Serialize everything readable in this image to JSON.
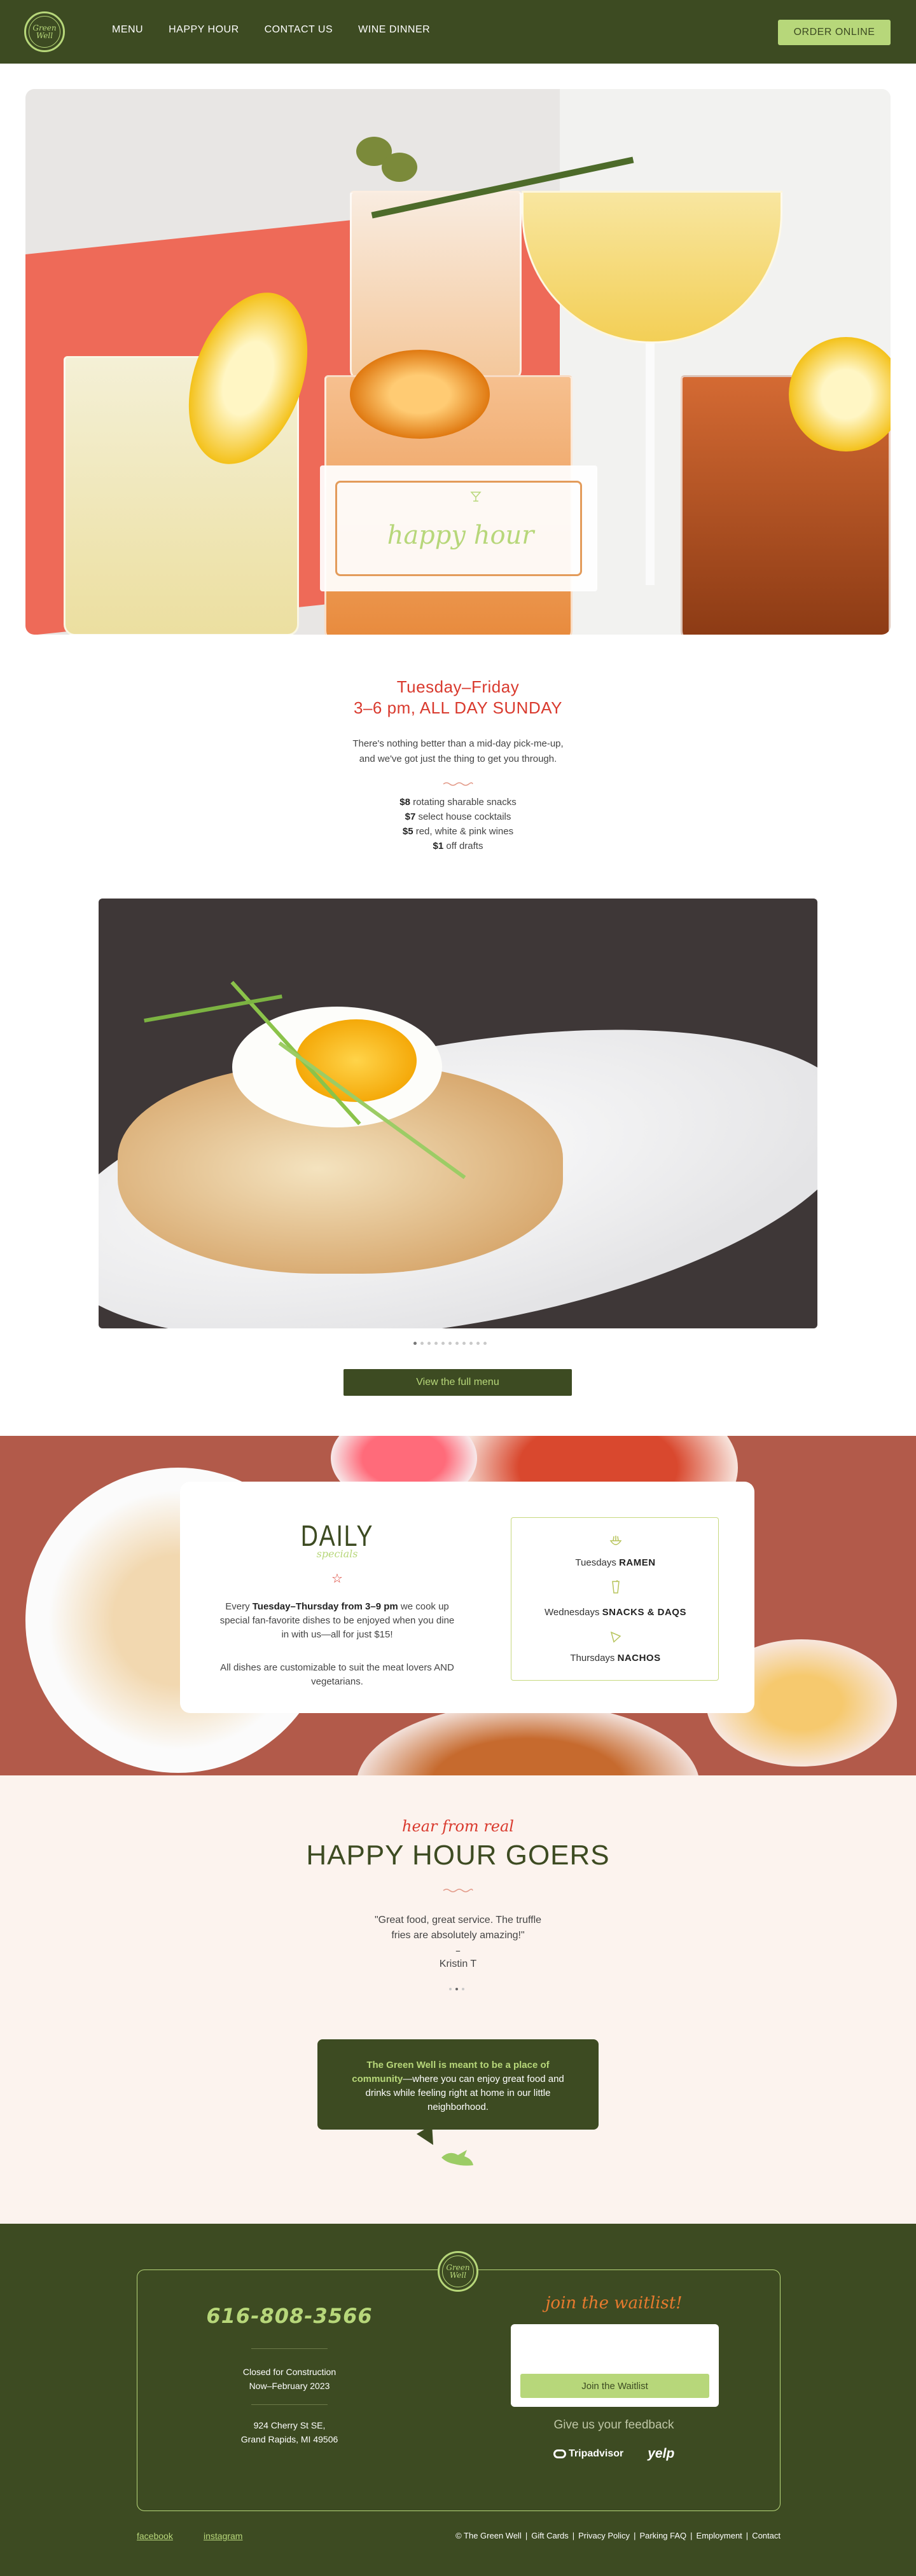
{
  "header": {
    "logo_text": "Green Well",
    "nav": [
      "MENU",
      "HAPPY HOUR",
      "CONTACT US",
      "WINE DINNER"
    ],
    "order_label": "ORDER ONLINE",
    "colors": {
      "bg": "#3d4b22",
      "accent": "#b7d77a"
    }
  },
  "hero": {
    "card_title": "happy hour",
    "card_icon": "cocktail-icon"
  },
  "happy_hour": {
    "days": "Tuesday–Friday",
    "time": "3–6 pm, ALL DAY SUNDAY",
    "intro_line1": "There's nothing better than a mid-day pick-me-up,",
    "intro_line2": "and we've got just the thing to get you through.",
    "specials": [
      {
        "price": "$8",
        "text": " rotating sharable snacks"
      },
      {
        "price": "$7",
        "text": " select house cocktails"
      },
      {
        "price": "$5",
        "text": " red, white & pink wines"
      },
      {
        "price": "$1",
        "text": " off drafts"
      }
    ]
  },
  "carousel": {
    "slide_count": 11,
    "active_index": 0,
    "menu_button": "View the full menu"
  },
  "daily": {
    "title": "DAILY",
    "subtitle": "specials",
    "text_pre": "Every ",
    "text_bold": "Tuesday–Thursday from 3–9 pm",
    "text_post": " we cook up special fan-favorite dishes to be enjoyed when you dine in with us—all for just $15!",
    "text2": "All dishes are customizable to suit the meat lovers AND vegetarians.",
    "days": [
      {
        "day": "Tuesdays ",
        "dish": "RAMEN",
        "icon": "ramen-bowl-icon"
      },
      {
        "day": "Wednesdays ",
        "dish": "SNACKS & DAQS",
        "icon": "cocktail-glass-icon"
      },
      {
        "day": "Thursdays ",
        "dish": "NACHOS",
        "icon": "nacho-chip-icon"
      }
    ]
  },
  "testimonial": {
    "kicker": "hear from real",
    "title": "HAPPY HOUR GOERS",
    "quote_line1": "\"Great food, great service. The truffle",
    "quote_line2": "fries are absolutely amazing!\"",
    "dash": "–",
    "author": "Kristin T",
    "dot_count": 3,
    "bubble_bold": "The Green Well is meant to be a place of community",
    "bubble_rest": "—where you can enjoy great food and drinks while feeling right at home in our little neighborhood."
  },
  "footer": {
    "phone": "616-808-3566",
    "closed_line1": "Closed for Construction",
    "closed_line2": "Now–February 2023",
    "address_line1": "924 Cherry St SE,",
    "address_line2": "Grand Rapids, MI 49506",
    "waitlist_title": "join the waitlist!",
    "waitlist_button": "Join the Waitlist",
    "feedback": "Give us your feedback",
    "tripadvisor": "Tripadvisor",
    "yelp": "yelp",
    "facebook": "facebook",
    "instagram": "instagram",
    "legal": [
      "© The Green Well",
      "Gift Cards",
      "Privacy Policy",
      "Parking FAQ",
      "Employment",
      "Contact"
    ]
  }
}
